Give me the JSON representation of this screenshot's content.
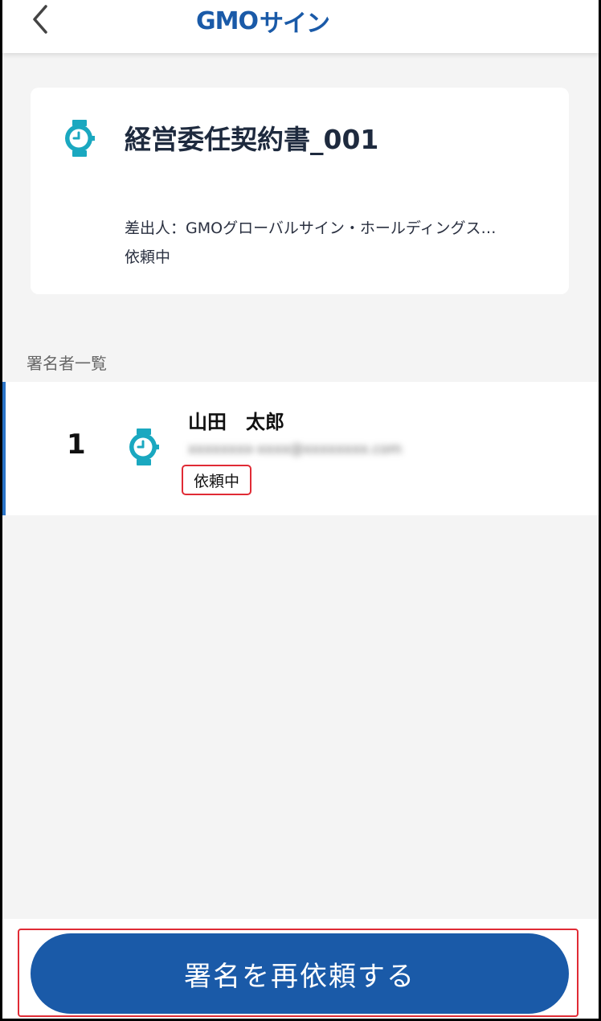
{
  "header": {
    "logo_gmo": "GMO",
    "logo_sign": "サイン"
  },
  "document": {
    "title": "経営委任契約書_001",
    "sender": "差出人：GMOグローバルサイン・ホールディングス…",
    "status": "依頼中"
  },
  "signers_section": {
    "label": "署名者一覧",
    "signers": [
      {
        "number": "1",
        "name": "山田　太郎",
        "email": "xxxxxxxx-xxxx@xxxxxxxx.com",
        "status": "依頼中"
      }
    ]
  },
  "footer": {
    "resend_label": "署名を再依頼する"
  },
  "colors": {
    "brand_blue": "#1a5aa8",
    "icon_teal": "#1aa8c0",
    "highlight_red": "#e02b35",
    "row_accent": "#2a74c8"
  }
}
